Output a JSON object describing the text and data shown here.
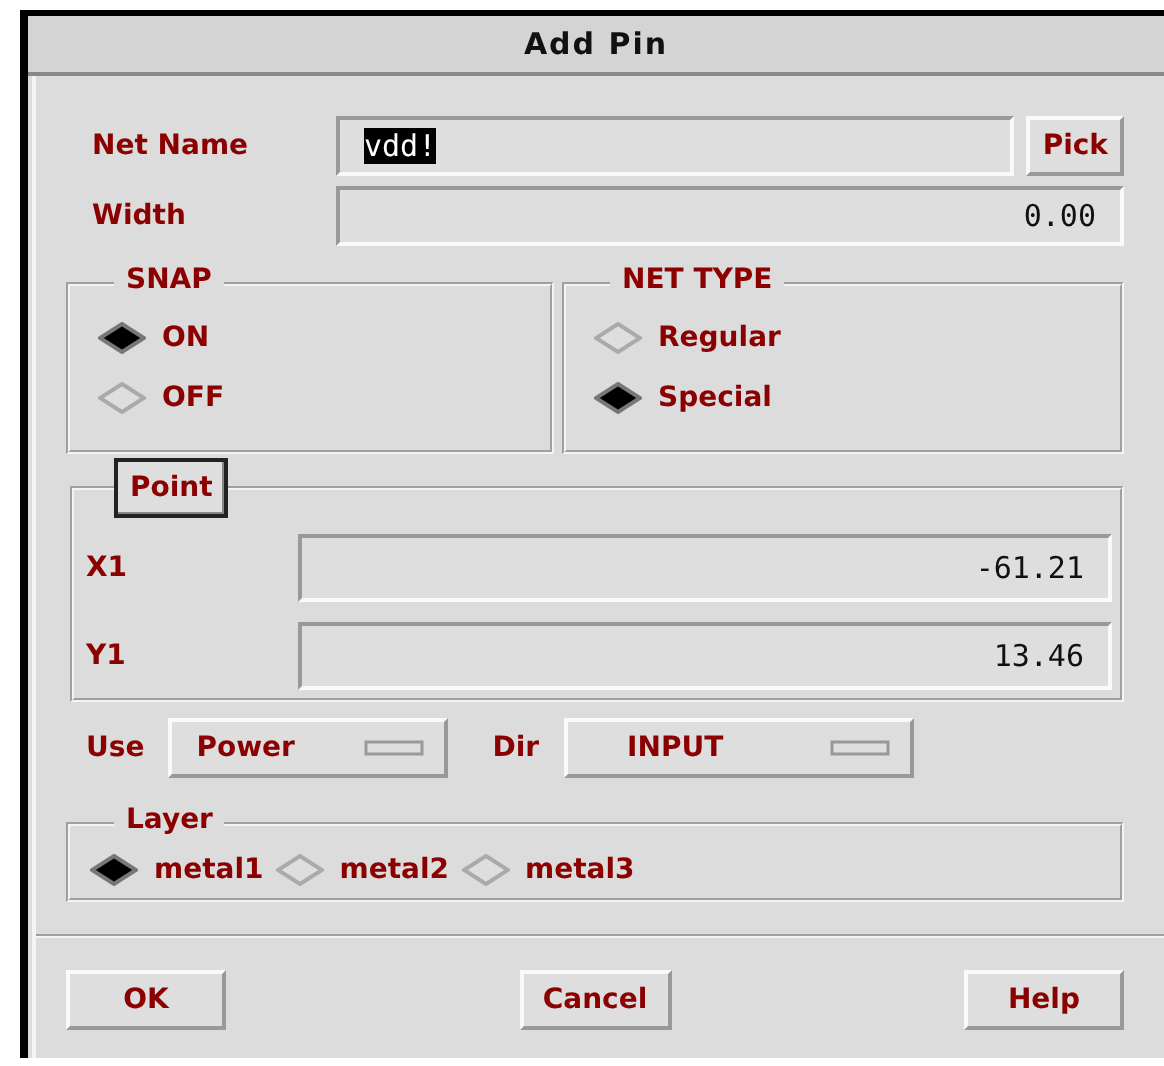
{
  "window": {
    "title": "Add Pin"
  },
  "net_name": {
    "label": "Net Name",
    "value": "vdd!",
    "highlighted": true,
    "button": "Pick"
  },
  "width": {
    "label": "Width",
    "value": "0.00"
  },
  "snap": {
    "title": "SNAP",
    "options": [
      {
        "label": "ON",
        "selected": true
      },
      {
        "label": "OFF",
        "selected": false
      }
    ]
  },
  "net_type": {
    "title": "NET TYPE",
    "options": [
      {
        "label": "Regular",
        "selected": false
      },
      {
        "label": "Special",
        "selected": true
      }
    ]
  },
  "point": {
    "button": "Point",
    "fields": [
      {
        "label": "X1",
        "value": "-61.21"
      },
      {
        "label": "Y1",
        "value": "13.46"
      }
    ]
  },
  "use": {
    "label": "Use",
    "value": "Power"
  },
  "dir": {
    "label": "Dir",
    "value": "INPUT"
  },
  "layer": {
    "title": "Layer",
    "options": [
      {
        "label": "metal1",
        "selected": true
      },
      {
        "label": "metal2",
        "selected": false
      },
      {
        "label": "metal3",
        "selected": false
      }
    ]
  },
  "buttons": [
    "OK",
    "Cancel",
    "Help"
  ]
}
